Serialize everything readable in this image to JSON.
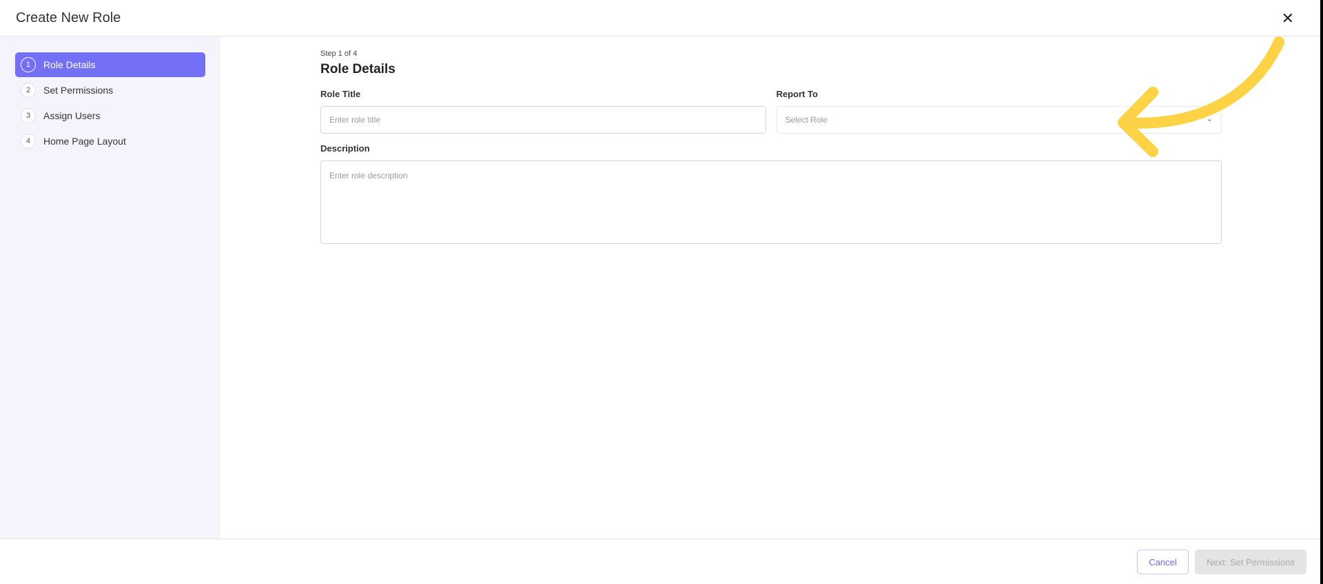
{
  "header": {
    "title": "Create New Role",
    "close_icon": "close-icon"
  },
  "sidebar": {
    "steps": [
      {
        "num": "1",
        "label": "Role Details"
      },
      {
        "num": "2",
        "label": "Set Permissions"
      },
      {
        "num": "3",
        "label": "Assign Users"
      },
      {
        "num": "4",
        "label": "Home Page Layout"
      }
    ]
  },
  "main": {
    "step_indicator": "Step 1 of 4",
    "title": "Role Details",
    "role_title": {
      "label": "Role Title",
      "placeholder": "Enter role title"
    },
    "report_to": {
      "label": "Report To",
      "placeholder": "Select Role"
    },
    "description": {
      "label": "Description",
      "placeholder": "Enter role description"
    }
  },
  "footer": {
    "cancel": "Cancel",
    "next": "Next: Set Permissions"
  },
  "colors": {
    "accent": "#7470f6",
    "annotation": "#fdd244"
  }
}
